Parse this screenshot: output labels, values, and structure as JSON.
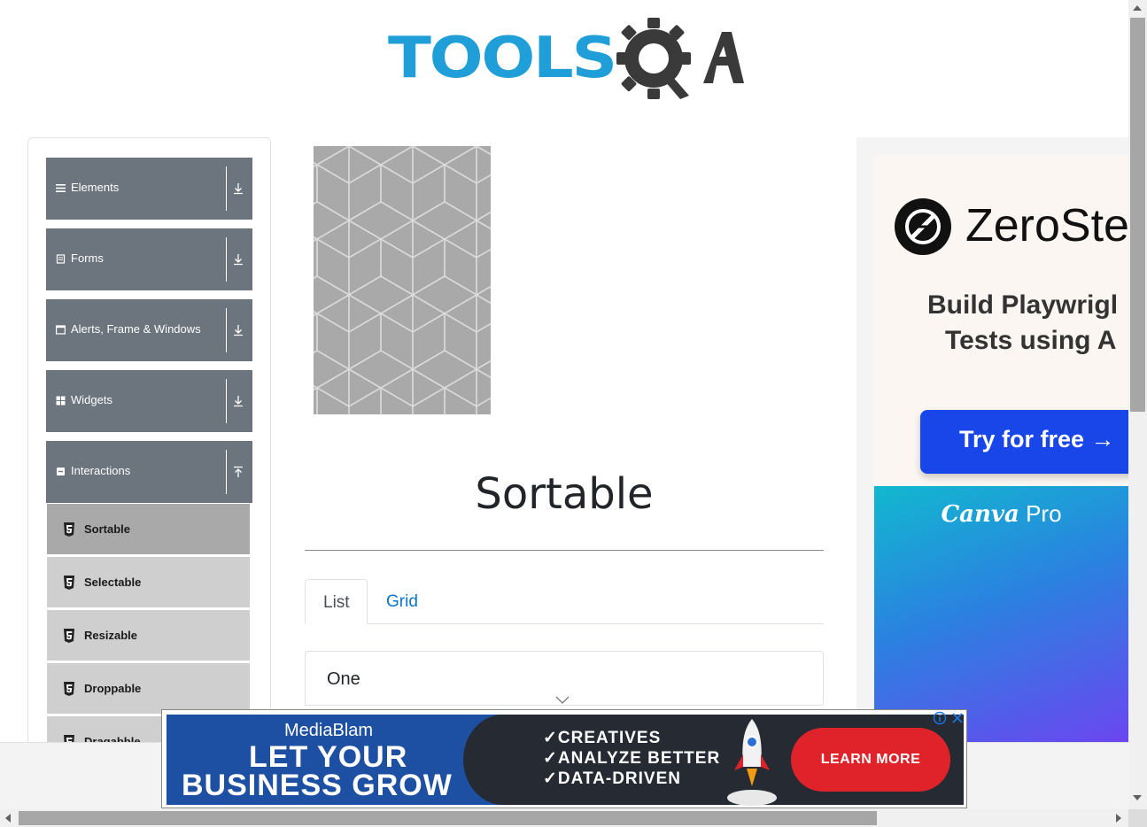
{
  "logo": {
    "text_part": "TOOLS",
    "alt": "TOOLSQA"
  },
  "sidebar": {
    "groups": [
      {
        "label": "Elements",
        "icon": "menu-lines-icon",
        "arrow": "expand-down-icon"
      },
      {
        "label": "Forms",
        "icon": "form-icon",
        "arrow": "expand-down-icon"
      },
      {
        "label": "Alerts, Frame & Windows",
        "icon": "window-icon",
        "arrow": "expand-down-icon"
      },
      {
        "label": "Widgets",
        "icon": "grid-icon",
        "arrow": "expand-down-icon"
      },
      {
        "label": "Interactions",
        "icon": "interaction-icon",
        "arrow": "collapse-up-icon"
      }
    ],
    "interactions_items": [
      {
        "label": "Sortable",
        "active": true
      },
      {
        "label": "Selectable",
        "active": false
      },
      {
        "label": "Resizable",
        "active": false
      },
      {
        "label": "Droppable",
        "active": false
      },
      {
        "label": "Dragabble",
        "active": false
      }
    ]
  },
  "main": {
    "title": "Sortable",
    "tabs": [
      {
        "label": "List",
        "active": true
      },
      {
        "label": "Grid",
        "active": false
      }
    ],
    "list_items": [
      "One"
    ]
  },
  "right_ad": {
    "brand": "ZeroSte",
    "headline_line1": "Build Playwrigl",
    "headline_line2": "Tests using A",
    "cta": "Try for free →",
    "second_ad_brand": "Canva",
    "second_ad_suffix": "Pro"
  },
  "bottom_ad": {
    "brand": "MediaBlam",
    "line1": "LET YOUR",
    "line2": "BUSINESS GROW",
    "checks": [
      "✓CREATIVES",
      "✓ANALYZE BETTER",
      "✓DATA-DRIVEN"
    ],
    "cta": "LEARN MORE"
  },
  "colors": {
    "logo_blue": "#1f9ed8",
    "logo_dark": "#3a3a3a",
    "sidebar_group": "#6c757d",
    "sidebar_item": "#cfcfcf",
    "sidebar_item_active": "#a9a9a9",
    "link": "#0b74cc",
    "ad_button": "#1846e8",
    "ad_cta_red": "#e0232a"
  }
}
